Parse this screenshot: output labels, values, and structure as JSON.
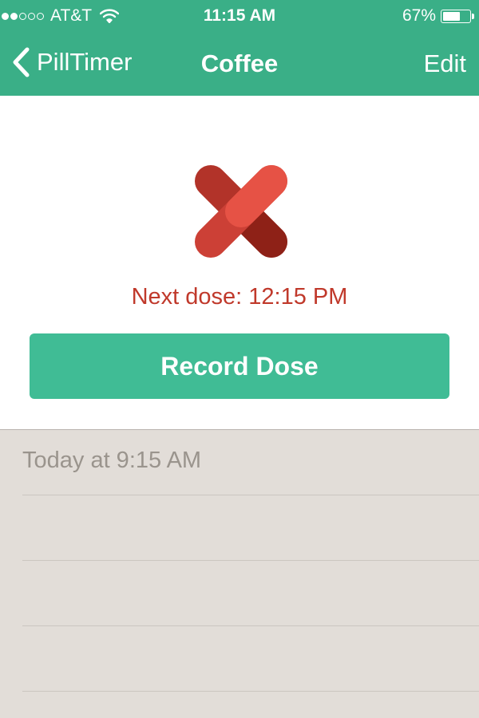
{
  "status_bar": {
    "carrier": "AT&T",
    "signal_bars_filled": 2,
    "signal_bars_total": 5,
    "time": "11:15 AM",
    "battery_percent_label": "67%",
    "battery_level": 0.67
  },
  "nav": {
    "back_label": "PillTimer",
    "title": "Coffee",
    "edit_label": "Edit"
  },
  "main": {
    "next_dose_text": "Next dose: 12:15 PM",
    "record_button_label": "Record Dose"
  },
  "history": {
    "entries": [
      "Today at 9:15 AM",
      "",
      "",
      ""
    ]
  },
  "colors": {
    "nav_green": "#3aaf87",
    "button_green": "#40bc95",
    "accent_red": "#c0392b",
    "history_bg": "#e2ddd8"
  },
  "icons": {
    "logo": "crossed-pills-icon",
    "back": "chevron-left-icon",
    "wifi": "wifi-icon",
    "battery": "battery-icon"
  }
}
